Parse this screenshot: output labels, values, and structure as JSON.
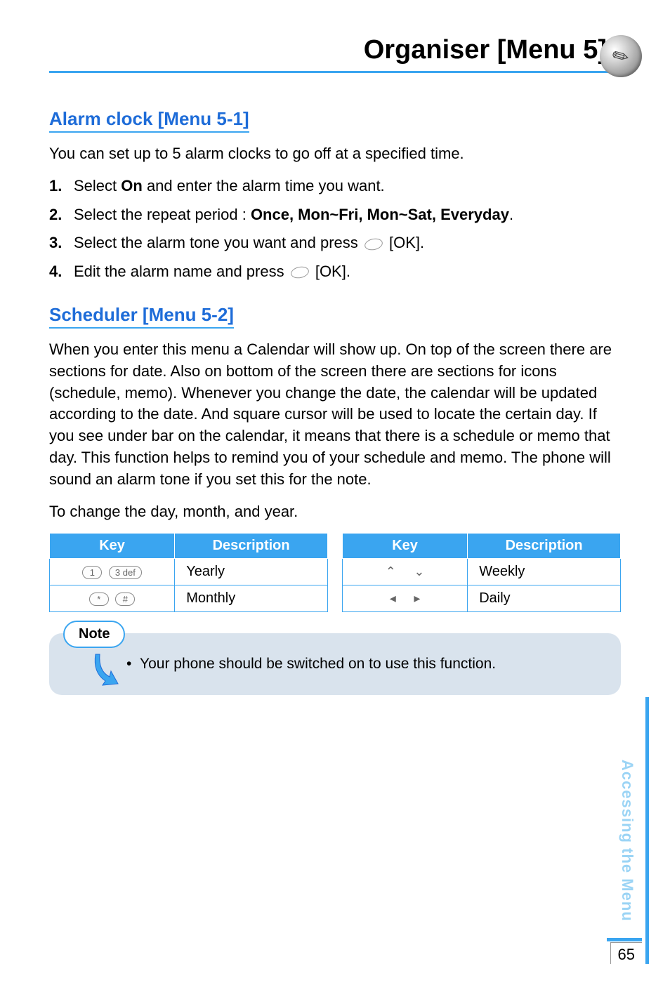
{
  "header": {
    "title": "Organiser [Menu 5]",
    "icon_name": "pen-icon"
  },
  "sections": {
    "alarm": {
      "heading": "Alarm clock [Menu 5-1]",
      "intro": "You can set up to 5 alarm clocks to go off at a specified time.",
      "steps": [
        {
          "num": "1.",
          "text_before": "Select ",
          "bold": "On",
          "text_after": " and enter the alarm time you want."
        },
        {
          "num": "2.",
          "text_before": "Select the repeat period : ",
          "bold": "Once, Mon~Fri, Mon~Sat, Everyday",
          "text_after": "."
        },
        {
          "num": "3.",
          "text_before": "Select the alarm tone you want and press ",
          "bold": "",
          "text_after": " [OK]."
        },
        {
          "num": "4.",
          "text_before": "Edit the alarm name and press ",
          "bold": "",
          "text_after": " [OK]."
        }
      ]
    },
    "scheduler": {
      "heading": "Scheduler [Menu 5-2]",
      "body": "When you enter this menu a Calendar will show up. On top of the screen there are sections for date. Also on bottom of the screen there are sections for icons (schedule, memo). Whenever you change the date, the calendar will be updated according to the date. And square cursor will be used to locate the certain day. If you see under bar on the calendar, it means that there is a schedule or memo that day. This function helps to remind you of your schedule and memo. The phone will sound an alarm tone if you set this for the note.",
      "change_text": "To change the day, month, and year."
    }
  },
  "table": {
    "headers": {
      "key": "Key",
      "description": "Description"
    },
    "left": [
      {
        "keys": [
          "1",
          "3 def"
        ],
        "description": "Yearly"
      },
      {
        "keys": [
          "*",
          "#"
        ],
        "description": "Monthly"
      }
    ],
    "right": [
      {
        "keys": [
          "up",
          "down"
        ],
        "description": "Weekly"
      },
      {
        "keys": [
          "left",
          "right"
        ],
        "description": "Daily"
      }
    ]
  },
  "chart_data": [
    {
      "type": "table",
      "title": "Navigation keys to change day, month, year",
      "columns": [
        "Key",
        "Description"
      ],
      "rows": [
        {
          "Key": "1 / 3",
          "Description": "Yearly"
        },
        {
          "Key": "* / #",
          "Description": "Monthly"
        },
        {
          "Key": "Up / Down",
          "Description": "Weekly"
        },
        {
          "Key": "Left / Right",
          "Description": "Daily"
        }
      ]
    }
  ],
  "note": {
    "label": "Note",
    "bullet": "Your phone should be switched on to use this function."
  },
  "side": {
    "text": "Accessing the Menu",
    "page": "65"
  },
  "icons": {
    "up": "⌃",
    "down": "⌄",
    "left": "◂",
    "right": "▸"
  }
}
